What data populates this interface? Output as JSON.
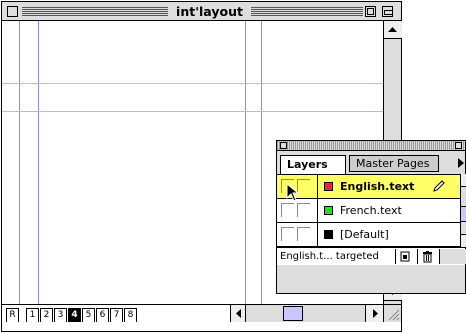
{
  "window": {
    "title": "int'layout"
  },
  "page_tabs": [
    {
      "label": "R",
      "active": false
    },
    {
      "label": "1",
      "active": false
    },
    {
      "label": "2",
      "active": false
    },
    {
      "label": "3",
      "active": false
    },
    {
      "label": "4",
      "active": true
    },
    {
      "label": "5",
      "active": false
    },
    {
      "label": "6",
      "active": false
    },
    {
      "label": "7",
      "active": false
    },
    {
      "label": "8",
      "active": false
    }
  ],
  "palette": {
    "tabs": {
      "layers": "Layers",
      "master_pages": "Master Pages"
    },
    "layers": [
      {
        "name": "English.text",
        "color": "#ff2020",
        "selected": true
      },
      {
        "name": "French.text",
        "color": "#20e020",
        "selected": false
      },
      {
        "name": "[Default]",
        "color": "#000000",
        "selected": false
      }
    ],
    "status": "English.t... targeted"
  },
  "colors": {
    "guide_vertical": "#8b8be8",
    "guide_horizontal": "#7fd8e0",
    "selection": "#ffff66"
  },
  "icons": {
    "pencil": "pencil-icon",
    "trash": "trash-icon",
    "new_layer": "new-layer-icon",
    "cursor": "arrow-cursor-icon"
  }
}
